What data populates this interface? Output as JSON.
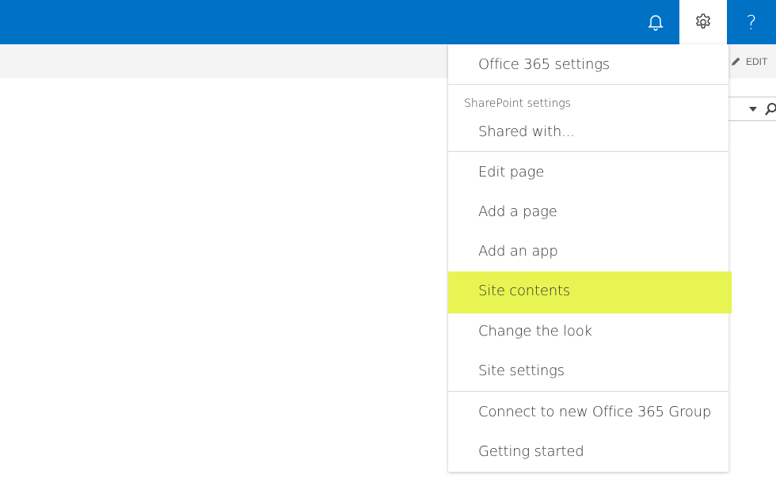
{
  "topbar": {
    "bell_icon": "bell-icon",
    "gear_icon": "gear-icon",
    "help_label": "?",
    "accent": "#0072c6"
  },
  "ribbon": {
    "edit_label": "EDIT",
    "edit_icon": "pencil-icon"
  },
  "menu": {
    "office_settings": "Office 365 settings",
    "sharepoint_heading": "SharePoint settings",
    "items": [
      "Shared with...",
      "Edit page",
      "Add a page",
      "Add an app",
      "Site contents",
      "Change the look",
      "Site settings",
      "Connect to new Office 365 Group",
      "Getting started"
    ],
    "highlight_color": "#e8f452"
  }
}
